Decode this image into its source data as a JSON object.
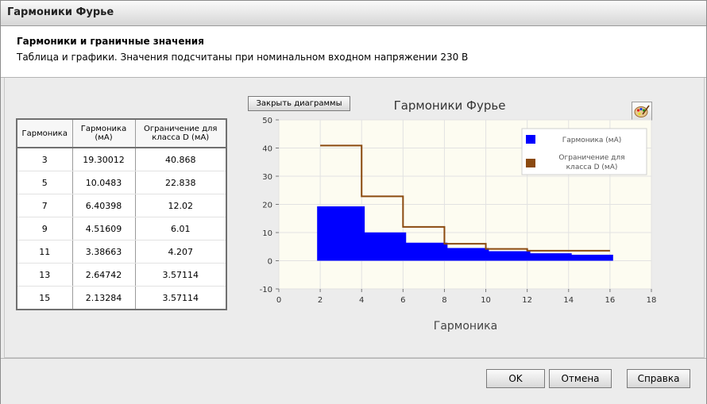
{
  "window": {
    "title": "Гармоники Фурье"
  },
  "header": {
    "title": "Гармоники и граничные значения",
    "subtitle": "Таблица и графики. Значения подсчитаны при номинальном входном напряжении 230 В"
  },
  "table": {
    "headers": [
      "Гармоника",
      "Гармоника (мА)",
      "Ограничение для класса D (мА)"
    ],
    "rows": [
      [
        "3",
        "19.30012",
        "40.868"
      ],
      [
        "5",
        "10.0483",
        "22.838"
      ],
      [
        "7",
        "6.40398",
        "12.02"
      ],
      [
        "9",
        "4.51609",
        "6.01"
      ],
      [
        "11",
        "3.38663",
        "4.207"
      ],
      [
        "13",
        "2.64742",
        "3.57114"
      ],
      [
        "15",
        "2.13284",
        "3.57114"
      ]
    ]
  },
  "toolbar": {
    "close_charts_label": "Закрыть диаграммы",
    "palette_icon": "palette-icon"
  },
  "chart_data": {
    "type": "bar",
    "title": "Гармоники Фурье",
    "xlabel": "Гармоника",
    "ylabel": "",
    "xlim": [
      0,
      18
    ],
    "ylim": [
      -10,
      50
    ],
    "xticks": [
      0,
      2,
      4,
      6,
      8,
      10,
      12,
      14,
      16,
      18
    ],
    "yticks": [
      -10,
      0,
      10,
      20,
      30,
      40,
      50
    ],
    "grid": true,
    "legend_position": "top-right",
    "series": [
      {
        "name": "Гармоника (мА)",
        "kind": "bar",
        "color": "#0000ff",
        "x": [
          3,
          5,
          7,
          9,
          11,
          13,
          15
        ],
        "values": [
          19.30012,
          10.0483,
          6.40398,
          4.51609,
          3.38663,
          2.64742,
          2.13284
        ]
      },
      {
        "name": "Ограничение для класса D (мА)",
        "kind": "step",
        "color": "#8b4a10",
        "x": [
          3,
          5,
          7,
          9,
          11,
          13,
          15
        ],
        "values": [
          40.868,
          22.838,
          12.02,
          6.01,
          4.207,
          3.57114,
          3.57114
        ]
      }
    ],
    "legend": [
      "Гармоника (мА)",
      "Ограничение для класса D (мА)"
    ]
  },
  "footer": {
    "ok_label": "OK",
    "cancel_label": "Отмена",
    "help_label": "Справка"
  }
}
